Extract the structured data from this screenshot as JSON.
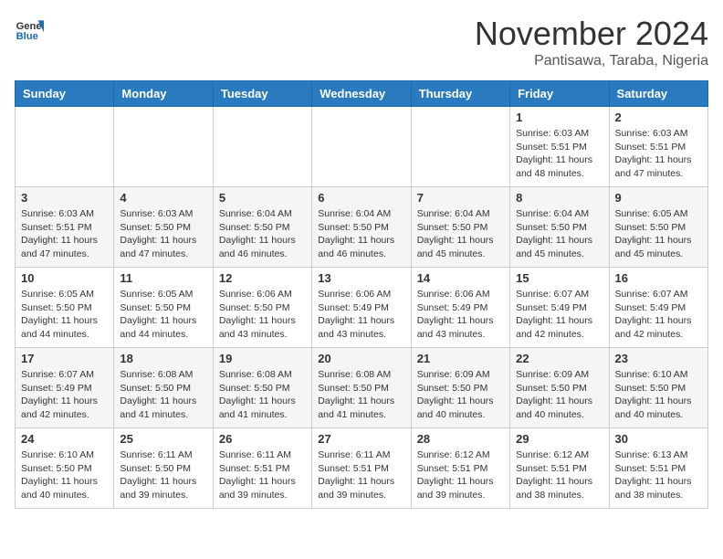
{
  "logo": {
    "general": "General",
    "blue": "Blue"
  },
  "header": {
    "month": "November 2024",
    "location": "Pantisawa, Taraba, Nigeria"
  },
  "weekdays": [
    "Sunday",
    "Monday",
    "Tuesday",
    "Wednesday",
    "Thursday",
    "Friday",
    "Saturday"
  ],
  "weeks": [
    [
      {
        "day": "",
        "info": ""
      },
      {
        "day": "",
        "info": ""
      },
      {
        "day": "",
        "info": ""
      },
      {
        "day": "",
        "info": ""
      },
      {
        "day": "",
        "info": ""
      },
      {
        "day": "1",
        "info": "Sunrise: 6:03 AM\nSunset: 5:51 PM\nDaylight: 11 hours and 48 minutes."
      },
      {
        "day": "2",
        "info": "Sunrise: 6:03 AM\nSunset: 5:51 PM\nDaylight: 11 hours and 47 minutes."
      }
    ],
    [
      {
        "day": "3",
        "info": "Sunrise: 6:03 AM\nSunset: 5:51 PM\nDaylight: 11 hours and 47 minutes."
      },
      {
        "day": "4",
        "info": "Sunrise: 6:03 AM\nSunset: 5:50 PM\nDaylight: 11 hours and 47 minutes."
      },
      {
        "day": "5",
        "info": "Sunrise: 6:04 AM\nSunset: 5:50 PM\nDaylight: 11 hours and 46 minutes."
      },
      {
        "day": "6",
        "info": "Sunrise: 6:04 AM\nSunset: 5:50 PM\nDaylight: 11 hours and 46 minutes."
      },
      {
        "day": "7",
        "info": "Sunrise: 6:04 AM\nSunset: 5:50 PM\nDaylight: 11 hours and 45 minutes."
      },
      {
        "day": "8",
        "info": "Sunrise: 6:04 AM\nSunset: 5:50 PM\nDaylight: 11 hours and 45 minutes."
      },
      {
        "day": "9",
        "info": "Sunrise: 6:05 AM\nSunset: 5:50 PM\nDaylight: 11 hours and 45 minutes."
      }
    ],
    [
      {
        "day": "10",
        "info": "Sunrise: 6:05 AM\nSunset: 5:50 PM\nDaylight: 11 hours and 44 minutes."
      },
      {
        "day": "11",
        "info": "Sunrise: 6:05 AM\nSunset: 5:50 PM\nDaylight: 11 hours and 44 minutes."
      },
      {
        "day": "12",
        "info": "Sunrise: 6:06 AM\nSunset: 5:50 PM\nDaylight: 11 hours and 43 minutes."
      },
      {
        "day": "13",
        "info": "Sunrise: 6:06 AM\nSunset: 5:49 PM\nDaylight: 11 hours and 43 minutes."
      },
      {
        "day": "14",
        "info": "Sunrise: 6:06 AM\nSunset: 5:49 PM\nDaylight: 11 hours and 43 minutes."
      },
      {
        "day": "15",
        "info": "Sunrise: 6:07 AM\nSunset: 5:49 PM\nDaylight: 11 hours and 42 minutes."
      },
      {
        "day": "16",
        "info": "Sunrise: 6:07 AM\nSunset: 5:49 PM\nDaylight: 11 hours and 42 minutes."
      }
    ],
    [
      {
        "day": "17",
        "info": "Sunrise: 6:07 AM\nSunset: 5:49 PM\nDaylight: 11 hours and 42 minutes."
      },
      {
        "day": "18",
        "info": "Sunrise: 6:08 AM\nSunset: 5:50 PM\nDaylight: 11 hours and 41 minutes."
      },
      {
        "day": "19",
        "info": "Sunrise: 6:08 AM\nSunset: 5:50 PM\nDaylight: 11 hours and 41 minutes."
      },
      {
        "day": "20",
        "info": "Sunrise: 6:08 AM\nSunset: 5:50 PM\nDaylight: 11 hours and 41 minutes."
      },
      {
        "day": "21",
        "info": "Sunrise: 6:09 AM\nSunset: 5:50 PM\nDaylight: 11 hours and 40 minutes."
      },
      {
        "day": "22",
        "info": "Sunrise: 6:09 AM\nSunset: 5:50 PM\nDaylight: 11 hours and 40 minutes."
      },
      {
        "day": "23",
        "info": "Sunrise: 6:10 AM\nSunset: 5:50 PM\nDaylight: 11 hours and 40 minutes."
      }
    ],
    [
      {
        "day": "24",
        "info": "Sunrise: 6:10 AM\nSunset: 5:50 PM\nDaylight: 11 hours and 40 minutes."
      },
      {
        "day": "25",
        "info": "Sunrise: 6:11 AM\nSunset: 5:50 PM\nDaylight: 11 hours and 39 minutes."
      },
      {
        "day": "26",
        "info": "Sunrise: 6:11 AM\nSunset: 5:51 PM\nDaylight: 11 hours and 39 minutes."
      },
      {
        "day": "27",
        "info": "Sunrise: 6:11 AM\nSunset: 5:51 PM\nDaylight: 11 hours and 39 minutes."
      },
      {
        "day": "28",
        "info": "Sunrise: 6:12 AM\nSunset: 5:51 PM\nDaylight: 11 hours and 39 minutes."
      },
      {
        "day": "29",
        "info": "Sunrise: 6:12 AM\nSunset: 5:51 PM\nDaylight: 11 hours and 38 minutes."
      },
      {
        "day": "30",
        "info": "Sunrise: 6:13 AM\nSunset: 5:51 PM\nDaylight: 11 hours and 38 minutes."
      }
    ]
  ]
}
